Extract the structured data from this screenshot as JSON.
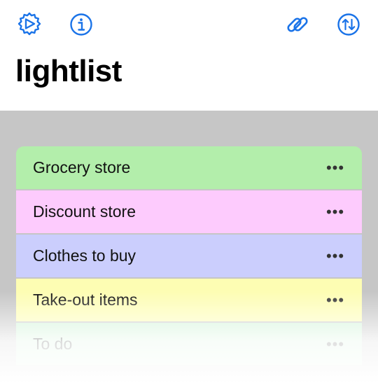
{
  "header": {
    "title": "lightlist",
    "icons": {
      "settings": "settings-icon",
      "info": "info-icon",
      "share_link": "link-icon",
      "sort": "sort-icon"
    }
  },
  "accent_color": "#1a73e8",
  "lists": [
    {
      "label": "Grocery store",
      "color": "#b3eeab",
      "more": "•••"
    },
    {
      "label": "Discount store",
      "color": "#fdcbfd",
      "more": "•••"
    },
    {
      "label": "Clothes to buy",
      "color": "#cbcefd",
      "more": "•••"
    },
    {
      "label": "Take-out items",
      "color": "#fdfdb3",
      "more": "•••"
    },
    {
      "label": "To do",
      "color": "#cff3d6",
      "more": "•••"
    }
  ]
}
